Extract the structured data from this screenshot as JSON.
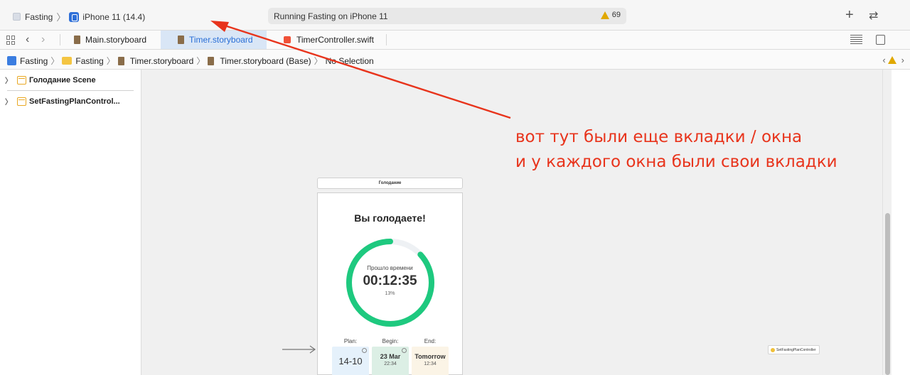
{
  "toolbar": {
    "scheme": "Fasting",
    "device": "iPhone 11 (14.4)",
    "status": "Running Fasting on iPhone 11",
    "warnings": "69",
    "plus_icon": "plus-icon",
    "swap_icon": "swap-arrows-icon"
  },
  "tabs": [
    {
      "label": "Main.storyboard"
    },
    {
      "label": "Timer.storyboard"
    },
    {
      "label": "TimerController.swift"
    }
  ],
  "breadcrumbs": [
    "Fasting",
    "Fasting",
    "Timer.storyboard",
    "Timer.storyboard (Base)",
    "No Selection"
  ],
  "outline": [
    {
      "label": "Голодание Scene"
    },
    {
      "label": "SetFastingPlanControl..."
    }
  ],
  "scene": {
    "title_bar": "Голодание",
    "heading": "Вы голодаете!",
    "ring_label": "Прошло времени",
    "elapsed": "00:12:35",
    "percent": "13%",
    "progress_fraction": 0.87,
    "ring_color": "#1ec97f",
    "plan_label": "Plan:",
    "begin_label": "Begin:",
    "end_label": "End:",
    "plan_value": "14-10",
    "begin_date": "23 Mar",
    "begin_time": "22:34",
    "end_date": "Tomorrow",
    "end_time": "12:34"
  },
  "canvas": {
    "set_plan_controller": "SetFastingPlanController"
  },
  "annotation": {
    "line1": "вот тут были еще вкладки / окна",
    "line2": "и у каждого окна были свои вкладки",
    "color": "#e8341c"
  }
}
